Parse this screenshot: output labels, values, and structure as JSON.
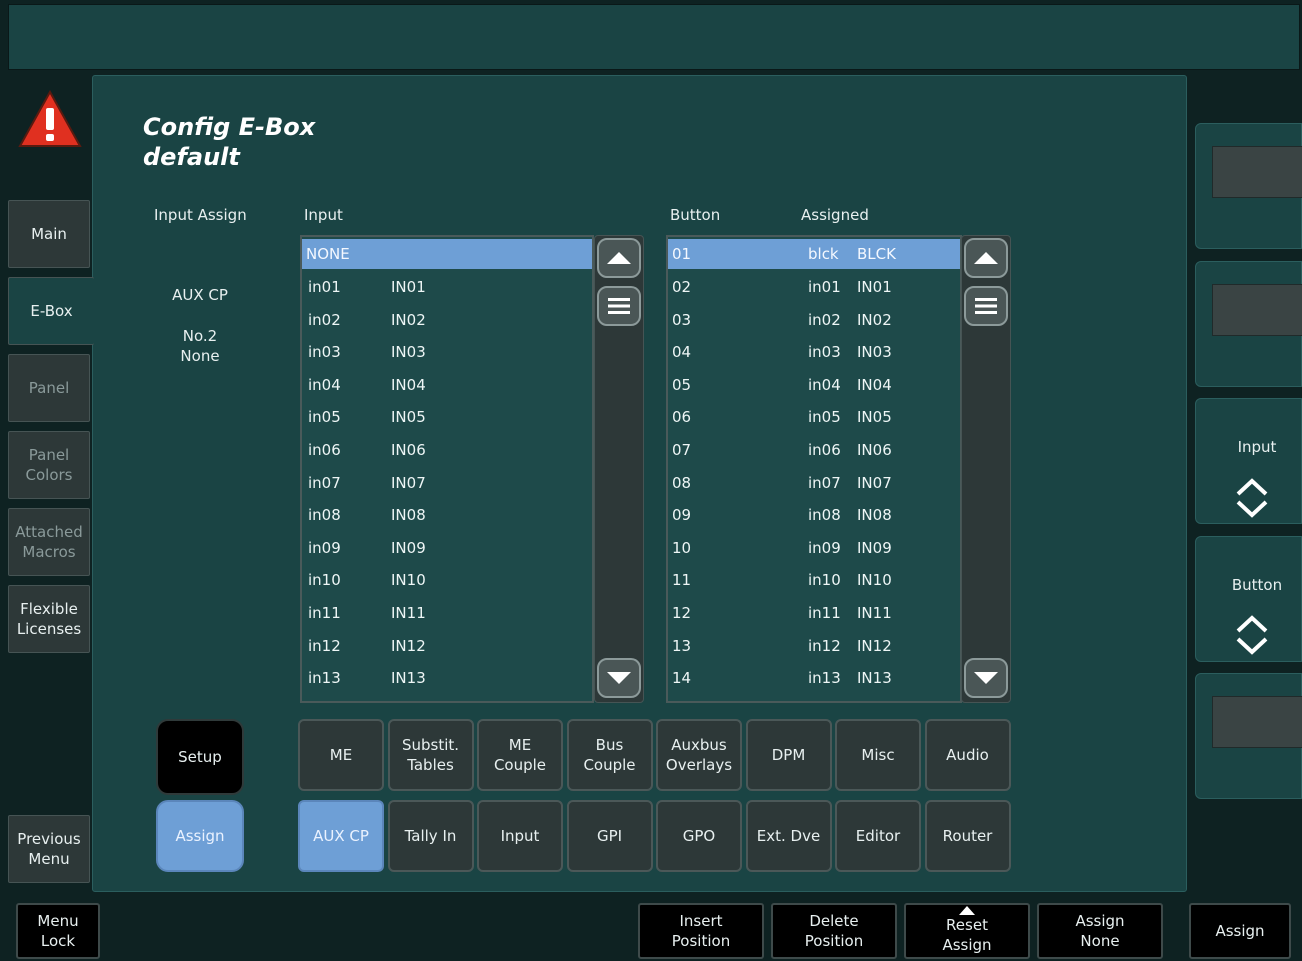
{
  "title": {
    "line1": "Config E-Box",
    "line2": "default"
  },
  "tabs": [
    {
      "label": "Main"
    },
    {
      "label": "E-Box"
    },
    {
      "label": "Panel"
    },
    {
      "label": "Panel\nColors"
    },
    {
      "label": "Attached\nMacros"
    },
    {
      "label": "Flexible\nLicenses"
    },
    {
      "label": "Previous\nMenu"
    }
  ],
  "info": {
    "heading": "Input Assign",
    "device": "AUX CP",
    "number": "No.2",
    "status": "None"
  },
  "input_list": {
    "header": "Input",
    "selected": "NONE",
    "rows": [
      {
        "a": "in01",
        "b": "IN01"
      },
      {
        "a": "in02",
        "b": "IN02"
      },
      {
        "a": "in03",
        "b": "IN03"
      },
      {
        "a": "in04",
        "b": "IN04"
      },
      {
        "a": "in05",
        "b": "IN05"
      },
      {
        "a": "in06",
        "b": "IN06"
      },
      {
        "a": "in07",
        "b": "IN07"
      },
      {
        "a": "in08",
        "b": "IN08"
      },
      {
        "a": "in09",
        "b": "IN09"
      },
      {
        "a": "in10",
        "b": "IN10"
      },
      {
        "a": "in11",
        "b": "IN11"
      },
      {
        "a": "in12",
        "b": "IN12"
      },
      {
        "a": "in13",
        "b": "IN13"
      }
    ]
  },
  "button_list": {
    "header_button": "Button",
    "header_assigned": "Assigned",
    "rows": [
      {
        "btn": "01",
        "a": "blck",
        "b": "BLCK"
      },
      {
        "btn": "02",
        "a": "in01",
        "b": "IN01"
      },
      {
        "btn": "03",
        "a": "in02",
        "b": "IN02"
      },
      {
        "btn": "04",
        "a": "in03",
        "b": "IN03"
      },
      {
        "btn": "05",
        "a": "in04",
        "b": "IN04"
      },
      {
        "btn": "06",
        "a": "in05",
        "b": "IN05"
      },
      {
        "btn": "07",
        "a": "in06",
        "b": "IN06"
      },
      {
        "btn": "08",
        "a": "in07",
        "b": "IN07"
      },
      {
        "btn": "09",
        "a": "in08",
        "b": "IN08"
      },
      {
        "btn": "10",
        "a": "in09",
        "b": "IN09"
      },
      {
        "btn": "11",
        "a": "in10",
        "b": "IN10"
      },
      {
        "btn": "12",
        "a": "in11",
        "b": "IN11"
      },
      {
        "btn": "13",
        "a": "in12",
        "b": "IN12"
      },
      {
        "btn": "14",
        "a": "in13",
        "b": "IN13"
      }
    ]
  },
  "mode_buttons": {
    "setup": "Setup",
    "assign": "Assign"
  },
  "category_row1": [
    "ME",
    "Substit.\nTables",
    "ME\nCouple",
    "Bus\nCouple",
    "Auxbus\nOverlays",
    "DPM",
    "Misc",
    "Audio"
  ],
  "category_row2": [
    "AUX CP",
    "Tally In",
    "Input",
    "GPI",
    "GPO",
    "Ext. Dve",
    "Editor",
    "Router"
  ],
  "right_panel": {
    "input_label": "Input",
    "button_label": "Button"
  },
  "bottom_bar": {
    "menu_lock": "Menu\nLock",
    "insert": "Insert\nPosition",
    "delete": "Delete\nPosition",
    "reset": "Reset\nAssign",
    "assign_none": "Assign\nNone",
    "assign": "Assign"
  },
  "colors": {
    "selection": "#6e9fd6",
    "panel": "#1a4444",
    "button": "#2d3838"
  }
}
